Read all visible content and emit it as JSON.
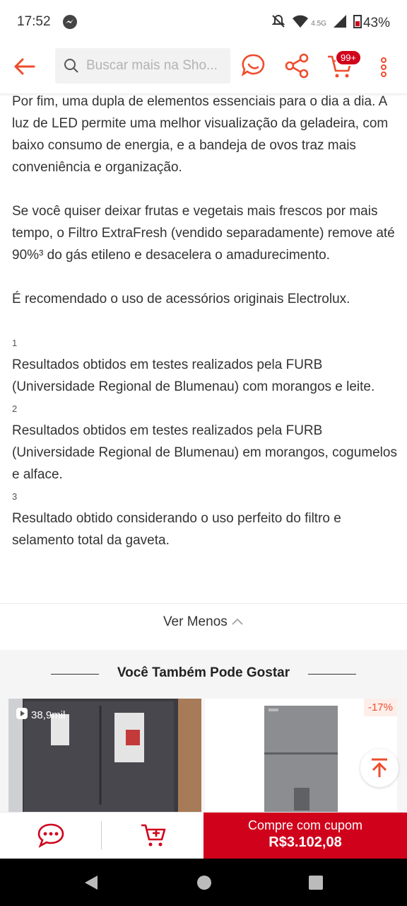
{
  "status": {
    "time": "17:52",
    "network": "4.5G",
    "battery": "43%"
  },
  "search": {
    "placeholder": "Buscar mais na Sho..."
  },
  "header": {
    "cart_badge": "99+"
  },
  "description": {
    "paragraphs": [
      "Por fim, uma dupla de elementos essenciais para o dia a dia. A luz de LED permite uma melhor visualização da geladeira, com baixo consumo de energia, e a bandeja de ovos traz mais conveniência e organização.",
      "Se você quiser deixar frutas e vegetais mais frescos por mais tempo, o Filtro ExtraFresh (vendido separadamente) remove até 90%³ do gás etileno e desacelera o amadurecimento.",
      "É recomendado o uso de acessórios originais Electrolux."
    ],
    "footnotes": [
      {
        "num": "1",
        "text": "Resultados obtidos em testes realizados pela FURB (Universidade Regional de Blumenau) com morangos e leite."
      },
      {
        "num": "2",
        "text": "Resultados obtidos em testes realizados pela FURB (Universidade Regional de Blumenau) em morangos, cogumelos e alface."
      },
      {
        "num": "3",
        "text": "Resultado obtido considerando o uso perfeito do filtro e selamento total da gaveta."
      }
    ]
  },
  "toggle": {
    "label": "Ver Menos"
  },
  "recommend": {
    "title": "Você Também Pode Gostar",
    "cards": [
      {
        "views": "38,9mil"
      },
      {
        "discount": "-17%"
      }
    ]
  },
  "action": {
    "buy_line1": "Compre com cupom",
    "buy_price": "R$3.102,08"
  },
  "colors": {
    "brand": "#d0011b",
    "accent": "#ee4d2d"
  }
}
